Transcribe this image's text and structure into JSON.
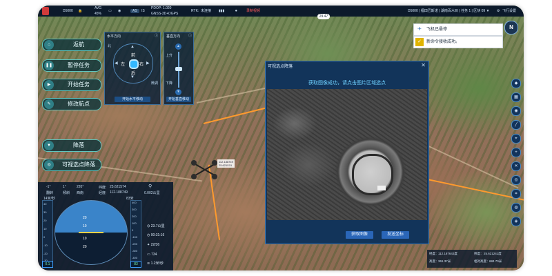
{
  "topbar": {
    "drone_id": "D5000",
    "avg_label": "AVG",
    "battery": "45%",
    "mode": "AS",
    "mode_sub": "IS",
    "pdop": "PDOP: 1.020",
    "gnss": "GNSS-3D+DGPS",
    "rtk_label": "RTK:",
    "rtk_status": "未连接",
    "record_status": "录制视频",
    "mission_info": "D5000 | 福田巴斯诺 | 湖南百木目 | 任务 1 | 区块 09 ▼",
    "flight_settings": "飞行设置",
    "speed": "29.47"
  },
  "commands": [
    {
      "label": "返航",
      "icon": "home-icon"
    },
    {
      "label": "暂停任务",
      "icon": "pause-icon"
    },
    {
      "label": "开始任务",
      "icon": "play-icon"
    },
    {
      "label": "修改航点",
      "icon": "waypoint-icon"
    },
    {
      "label": "降落",
      "icon": "land-icon"
    },
    {
      "label": "可视选点降落",
      "icon": "target-icon"
    }
  ],
  "horizontal_panel": {
    "title": "水平方向",
    "front": "前",
    "back": "后",
    "left": "左",
    "right": "右",
    "north": "北",
    "gear_small": "微调",
    "button": "开始水平移动"
  },
  "vertical_panel": {
    "title": "垂直方向",
    "up": "上升",
    "down": "下降",
    "button": "开始垂直移动"
  },
  "dialog": {
    "title": "可视选点降落",
    "message": "获取图像成功，请点击图片区域选点",
    "get_image": "获取图像",
    "send_coords": "发送坐标"
  },
  "notifications": [
    {
      "text": "飞机已悬停",
      "icon": "drone-icon",
      "color": "#2f6fb5"
    },
    {
      "text": "新命令接收成功。",
      "icon": "checkmark-icon",
      "color": "#e0b400"
    }
  ],
  "map_tag": {
    "line1": "112.188749",
    "line2": "25.621574"
  },
  "flight": {
    "roll": "-1°",
    "pitch": "1°",
    "heading": "220°",
    "roll_label": "翻转",
    "pitch_label": "倾斜",
    "heading_label": "西南",
    "lat_label": "纬度:",
    "lat": "25.621574",
    "lon_label": "经度:",
    "lon": "112.188749",
    "distance": "0.002公里",
    "speed_label": "14米/秒",
    "alt_label": "83米",
    "speed_value": "0.1",
    "alt_value": "83",
    "pitch_ticks": [
      "20",
      "10",
      "10",
      "20"
    ],
    "alt_ticks": [
      "400",
      "300",
      "200",
      "100",
      "0",
      "-100",
      "-200",
      "-300",
      "-400"
    ],
    "speed_ticks": [
      "40",
      "30",
      "20",
      "10",
      "0",
      "-10",
      "-20",
      "-30"
    ],
    "stats": [
      {
        "icon": "signal-icon",
        "value": "23.7公里"
      },
      {
        "icon": "timer-icon",
        "value": "00:31:16"
      },
      {
        "icon": "satellite-icon",
        "value": "22/36"
      },
      {
        "icon": "battery-icon",
        "value": "734"
      },
      {
        "icon": "wind-icon",
        "value": "1.2米/秒"
      }
    ]
  },
  "coords": {
    "lon_label": "经度：",
    "lon": "112.187643度",
    "lat_label": "纬度：",
    "lat": "25.621241度",
    "height_label": "高度：",
    "height": "361.37米",
    "alt_label": "相对高度：",
    "alt": "684.70米"
  }
}
